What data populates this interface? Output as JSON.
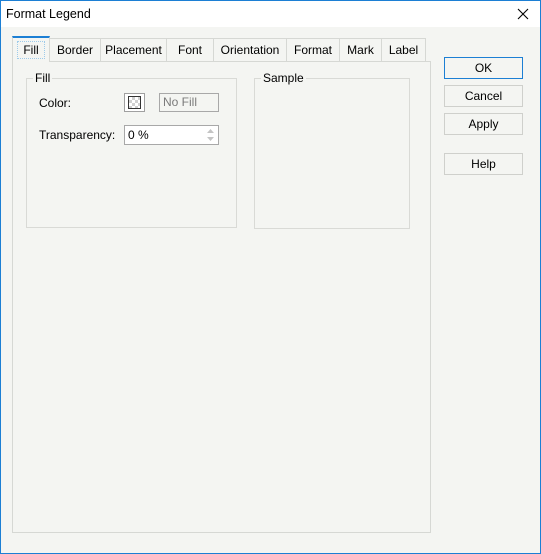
{
  "window": {
    "title": "Format Legend",
    "close_icon": "close-x-icon"
  },
  "tabs": [
    {
      "label": "Fill",
      "active": true
    },
    {
      "label": "Border",
      "active": false
    },
    {
      "label": "Placement",
      "active": false
    },
    {
      "label": "Font",
      "active": false
    },
    {
      "label": "Orientation",
      "active": false
    },
    {
      "label": "Format",
      "active": false
    },
    {
      "label": "Mark",
      "active": false
    },
    {
      "label": "Label",
      "active": false
    }
  ],
  "fill_group": {
    "legend": "Fill",
    "color_label": "Color:",
    "color_swatch_icon": "transparent-checker-icon",
    "color_value": "No Fill",
    "transparency_label": "Transparency:",
    "transparency_value": "0 %"
  },
  "sample_group": {
    "legend": "Sample"
  },
  "buttons": {
    "ok": "OK",
    "cancel": "Cancel",
    "apply": "Apply",
    "help": "Help"
  },
  "colors": {
    "accent": "#1c7fd4",
    "background": "#f4f5f2",
    "border": "#d6d8d4"
  }
}
